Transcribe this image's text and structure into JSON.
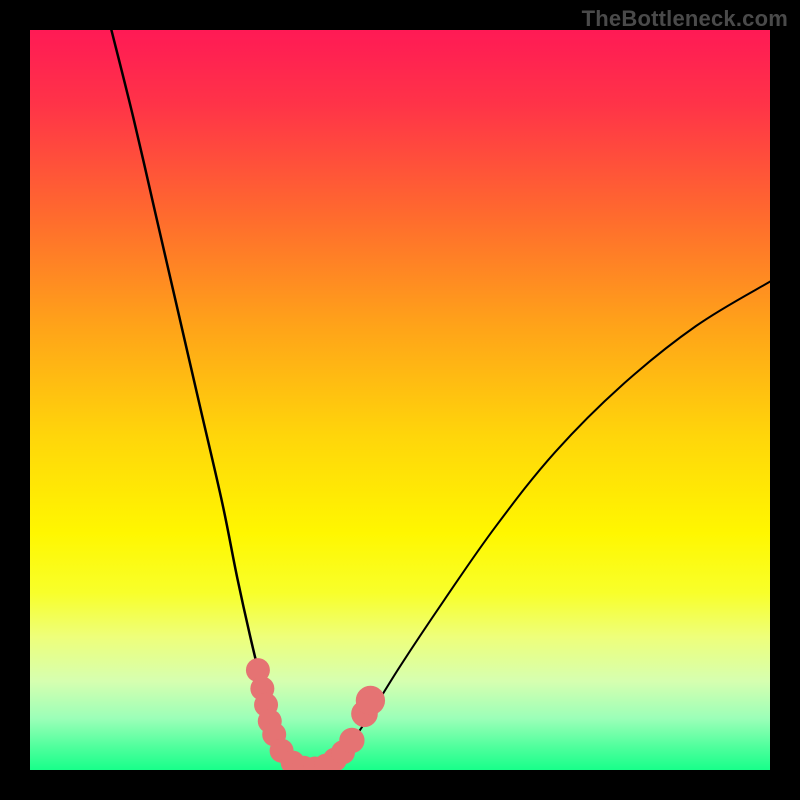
{
  "watermark": "TheBottleneck.com",
  "colors": {
    "curve": "#000000",
    "marker_fill": "#e57373",
    "marker_stroke": "#cf5b5b",
    "background_top": "#ff1a55",
    "background_bottom": "#18ff8a",
    "frame": "#000000"
  },
  "chart_data": {
    "type": "line",
    "title": "",
    "xlabel": "",
    "ylabel": "",
    "xlim": [
      0,
      100
    ],
    "ylim": [
      0,
      100
    ],
    "left_curve": {
      "name": "left-branch",
      "points": [
        {
          "x": 11.0,
          "y": 100.0
        },
        {
          "x": 14.0,
          "y": 88.0
        },
        {
          "x": 17.0,
          "y": 75.0
        },
        {
          "x": 20.0,
          "y": 62.0
        },
        {
          "x": 23.0,
          "y": 49.0
        },
        {
          "x": 26.0,
          "y": 36.0
        },
        {
          "x": 28.0,
          "y": 26.0
        },
        {
          "x": 30.0,
          "y": 17.0
        },
        {
          "x": 31.5,
          "y": 11.0
        },
        {
          "x": 33.0,
          "y": 6.0
        },
        {
          "x": 34.5,
          "y": 2.5
        },
        {
          "x": 36.0,
          "y": 0.5
        },
        {
          "x": 38.0,
          "y": 0.0
        }
      ]
    },
    "right_curve": {
      "name": "right-branch",
      "points": [
        {
          "x": 38.0,
          "y": 0.0
        },
        {
          "x": 40.0,
          "y": 0.5
        },
        {
          "x": 42.0,
          "y": 2.0
        },
        {
          "x": 45.0,
          "y": 6.0
        },
        {
          "x": 50.0,
          "y": 14.0
        },
        {
          "x": 56.0,
          "y": 23.0
        },
        {
          "x": 63.0,
          "y": 33.0
        },
        {
          "x": 71.0,
          "y": 43.0
        },
        {
          "x": 80.0,
          "y": 52.0
        },
        {
          "x": 90.0,
          "y": 60.0
        },
        {
          "x": 100.0,
          "y": 66.0
        }
      ]
    },
    "markers": [
      {
        "x": 30.8,
        "y": 13.5,
        "r": 1.2
      },
      {
        "x": 31.4,
        "y": 11.0,
        "r": 1.2
      },
      {
        "x": 31.9,
        "y": 8.8,
        "r": 1.2
      },
      {
        "x": 32.4,
        "y": 6.6,
        "r": 1.2
      },
      {
        "x": 33.0,
        "y": 4.8,
        "r": 1.2
      },
      {
        "x": 34.0,
        "y": 2.6,
        "r": 1.2
      },
      {
        "x": 35.5,
        "y": 1.0,
        "r": 1.2
      },
      {
        "x": 37.0,
        "y": 0.3,
        "r": 1.2
      },
      {
        "x": 38.5,
        "y": 0.2,
        "r": 1.2
      },
      {
        "x": 40.0,
        "y": 0.6,
        "r": 1.2
      },
      {
        "x": 41.2,
        "y": 1.4,
        "r": 1.2
      },
      {
        "x": 42.3,
        "y": 2.4,
        "r": 1.2
      },
      {
        "x": 43.5,
        "y": 4.0,
        "r": 1.3
      },
      {
        "x": 45.2,
        "y": 7.6,
        "r": 1.4
      },
      {
        "x": 46.0,
        "y": 9.4,
        "r": 1.6
      }
    ]
  }
}
